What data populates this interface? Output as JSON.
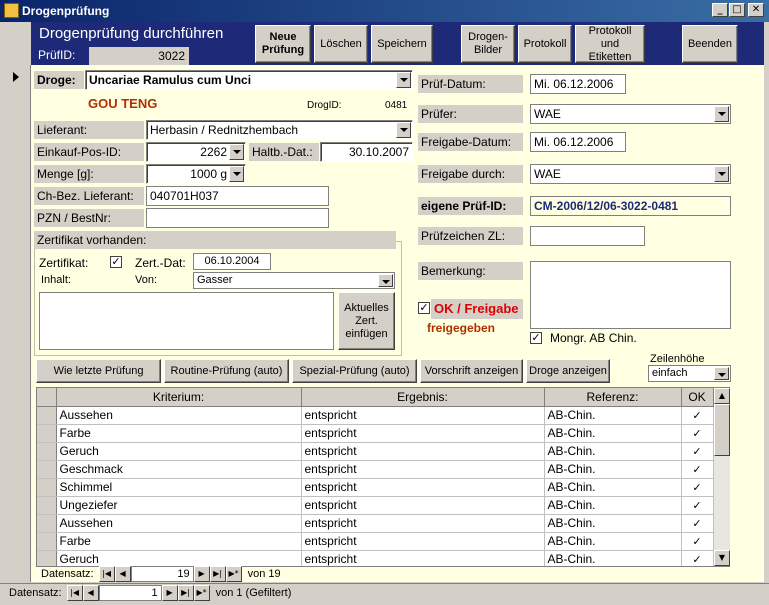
{
  "window": {
    "title": "Drogenprüfung",
    "minimize": "_",
    "maximize": "□",
    "close": "✕"
  },
  "header": {
    "title": "Drogenprüfung durchführen",
    "pruefid_label": "PrüfID:",
    "pruefid_value": "3022"
  },
  "toolbar": {
    "neue_pruefung": "Neue Prüfung",
    "loeschen": "Löschen",
    "speichern": "Speichern",
    "drogen_bilder": "Drogen-Bilder",
    "protokoll": "Protokoll",
    "protokoll_etiketten": "Protokoll und Etiketten",
    "beenden": "Beenden"
  },
  "drug": {
    "label": "Droge:",
    "value": "Uncariae Ramulus cum Unci",
    "chinese_name": "GOU TENG",
    "drogid_label": "DrogID:",
    "drogid_value": "0481"
  },
  "left_fields": {
    "lieferant_label": "Lieferant:",
    "lieferant_value": "Herbasin / Rednitzhembach",
    "einkauf_label": "Einkauf-Pos-ID:",
    "einkauf_value": "2262",
    "haltb_label": "Haltb.-Dat.:",
    "haltb_value": "30.10.2007",
    "menge_label": "Menge [g]:",
    "menge_value": "1000 g",
    "chbez_label": "Ch-Bez. Lieferant:",
    "chbez_value": "040701H037",
    "pzn_label": "PZN / BestNr:",
    "pzn_value": ""
  },
  "certificate": {
    "section_label": "Zertifikat vorhanden:",
    "zertifikat_label": "Zertifikat:",
    "zertifikat_checked": "✓",
    "zertdat_label": "Zert.-Dat:",
    "zertdat_value": "06.10.2004",
    "inhalt_label": "Inhalt:",
    "von_label": "Von:",
    "von_value": "Gasser",
    "aktuelles_button": "Aktuelles Zert. einfügen"
  },
  "right_fields": {
    "pruefdatum_label": "Prüf-Datum:",
    "pruefdatum_value": "Mi. 06.12.2006",
    "pruefer_label": "Prüfer:",
    "pruefer_value": "WAE",
    "freigabedatum_label": "Freigabe-Datum:",
    "freigabedatum_value": "Mi. 06.12.2006",
    "freigabedurch_label": "Freigabe durch:",
    "freigabedurch_value": "WAE",
    "eigene_label": "eigene Prüf-ID:",
    "eigene_value": "CM-2006/12/06-3022-0481",
    "pruefzeichen_label": "Prüfzeichen ZL:",
    "pruefzeichen_value": "",
    "bemerkung_label": "Bemerkung:",
    "ok_label": "OK / Freigabe",
    "ok_checked": "✓",
    "freigegeben": "freigegeben",
    "mongr_label": "Mongr. AB Chin.",
    "mongr_checked": "✓"
  },
  "action_buttons": {
    "wie_letzte": "Wie letzte Prüfung",
    "routine": "Routine-Prüfung (auto)",
    "spezial": "Spezial-Prüfung (auto)",
    "vorschrift": "Vorschrift anzeigen",
    "droge_anzeigen": "Droge anzeigen",
    "zeilenhoehe_label": "Zeilenhöhe",
    "zeilenhoehe_value": "einfach"
  },
  "grid": {
    "columns": [
      "Kriterium:",
      "Ergebnis:",
      "Referenz:",
      "OK"
    ],
    "rows": [
      [
        "Aussehen",
        "entspricht",
        "AB-Chin.",
        "✓"
      ],
      [
        "Farbe",
        "entspricht",
        "AB-Chin.",
        "✓"
      ],
      [
        "Geruch",
        "entspricht",
        "AB-Chin.",
        "✓"
      ],
      [
        "Geschmack",
        "entspricht",
        "AB-Chin.",
        "✓"
      ],
      [
        "Schimmel",
        "entspricht",
        "AB-Chin.",
        "✓"
      ],
      [
        "Ungeziefer",
        "entspricht",
        "AB-Chin.",
        "✓"
      ],
      [
        "Aussehen",
        "entspricht",
        "AB-Chin.",
        "✓"
      ],
      [
        "Farbe",
        "entspricht",
        "AB-Chin.",
        "✓"
      ],
      [
        "Geruch",
        "entspricht",
        "AB-Chin.",
        "✓"
      ]
    ]
  },
  "subform_nav": {
    "label": "Datensatz:",
    "current": "19",
    "of_label": "von 19"
  },
  "main_nav": {
    "label": "Datensatz:",
    "current": "1",
    "of_label": "von  1 (Gefiltert)"
  }
}
